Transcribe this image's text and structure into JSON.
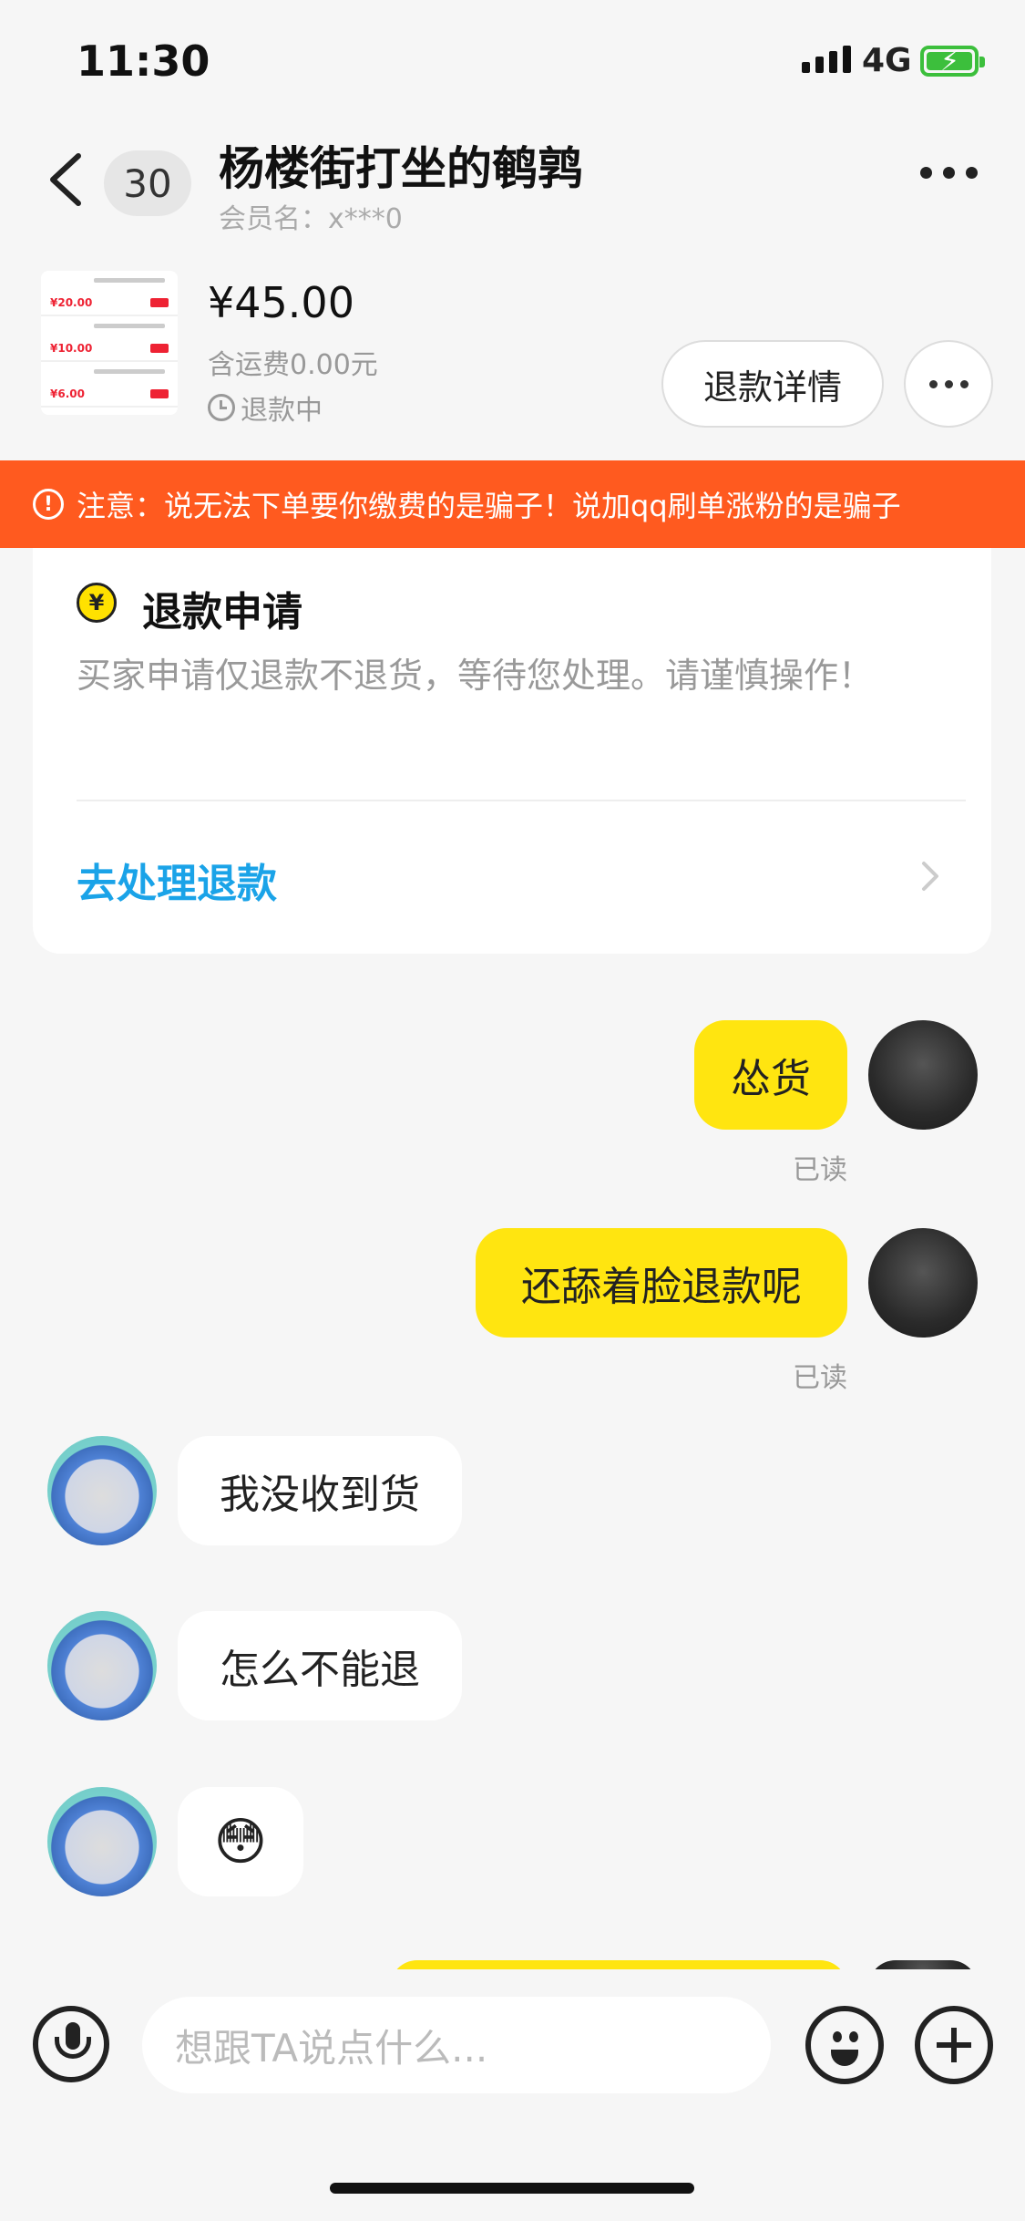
{
  "status_bar": {
    "time": "11:30",
    "network": "4G"
  },
  "header": {
    "unread_count": "30",
    "title": "杨楼街打坐的鹌鹑",
    "subtitle": "会员名：x***0"
  },
  "order": {
    "price": "¥45.00",
    "shipping": "含运费0.00元",
    "status": "退款中",
    "refund_detail_label": "退款详情",
    "thumb_amounts": [
      "¥20.00",
      "¥10.00",
      "¥6.00"
    ]
  },
  "warning": {
    "icon_label": "!",
    "text": "注意：说无法下单要你缴费的是骗子！说加qq刷单涨粉的是骗子"
  },
  "refund_card": {
    "icon_label": "¥",
    "title": "退款申请",
    "description": "买家申请仅退款不退货，等待您处理。请谨慎操作！",
    "action": "去处理退款"
  },
  "messages": [
    {
      "from": "me",
      "text": "怂货",
      "status": "已读"
    },
    {
      "from": "me",
      "text": "还舔着脸退款呢",
      "status": "已读"
    },
    {
      "from": "other",
      "text": "我没收到货"
    },
    {
      "from": "other",
      "text": "怎么不能退"
    },
    {
      "from": "other",
      "text": "😳",
      "icon": "shy-face-emoji"
    }
  ],
  "input": {
    "placeholder": "想跟TA说点什么..."
  },
  "colors": {
    "accent_yellow": "#ffe510",
    "warning_orange": "#ff5a1f",
    "link_blue": "#1aa3e8"
  }
}
